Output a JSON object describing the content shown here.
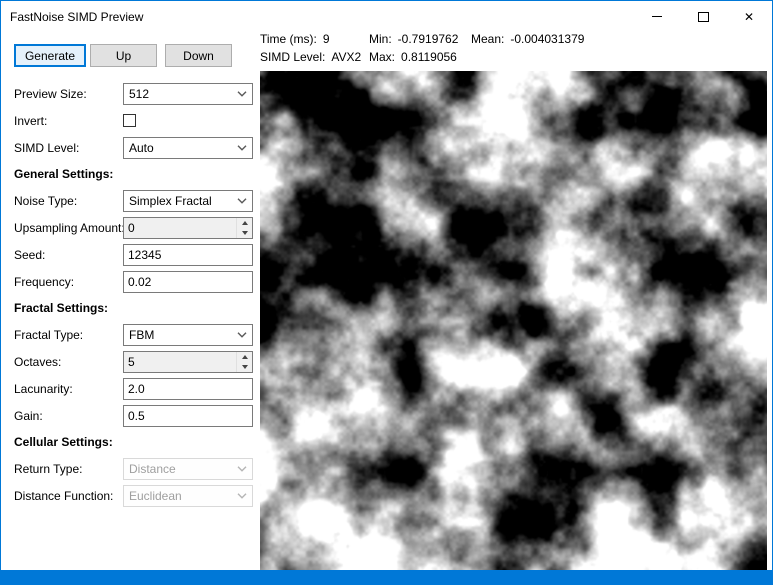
{
  "window": {
    "title": "FastNoise SIMD Preview",
    "close_glyph": "✕"
  },
  "buttons": {
    "generate": "Generate",
    "up": "Up",
    "down": "Down"
  },
  "stats": {
    "time_label": "Time (ms):",
    "time_value": "9",
    "simd_label": "SIMD Level:",
    "simd_value": "AVX2",
    "min_label": "Min:",
    "min_value": "-0.7919762",
    "max_label": "Max:",
    "max_value": "0.8119056",
    "mean_label": "Mean:",
    "mean_value": "-0.004031379"
  },
  "sections": {
    "general": "General Settings:",
    "fractal": "Fractal Settings:",
    "cellular": "Cellular Settings:"
  },
  "fields": {
    "preview_size": {
      "label": "Preview Size:",
      "value": "512"
    },
    "invert": {
      "label": "Invert:",
      "checked": false
    },
    "simd_level": {
      "label": "SIMD Level:",
      "value": "Auto"
    },
    "noise_type": {
      "label": "Noise Type:",
      "value": "Simplex Fractal"
    },
    "upsampling": {
      "label": "Upsampling Amount:",
      "value": "0"
    },
    "seed": {
      "label": "Seed:",
      "value": "12345"
    },
    "frequency": {
      "label": "Frequency:",
      "value": "0.02"
    },
    "fractal_type": {
      "label": "Fractal Type:",
      "value": "FBM"
    },
    "octaves": {
      "label": "Octaves:",
      "value": "5"
    },
    "lacunarity": {
      "label": "Lacunarity:",
      "value": "2.0"
    },
    "gain": {
      "label": "Gain:",
      "value": "0.5"
    },
    "return_type": {
      "label": "Return Type:",
      "value": "Distance",
      "disabled": true
    },
    "distance_function": {
      "label": "Distance Function:",
      "value": "Euclidean",
      "disabled": true
    }
  },
  "noise": {
    "seed": 12345,
    "frequency": 0.02,
    "octaves": 5,
    "lacunarity": 2.0,
    "gain": 0.5
  }
}
